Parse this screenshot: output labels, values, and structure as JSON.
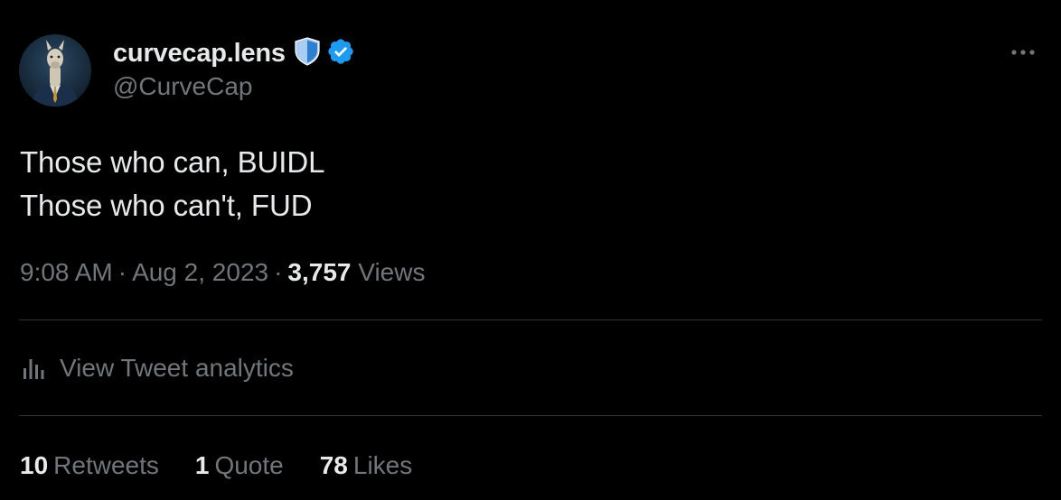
{
  "author": {
    "display_name": "curvecap.lens",
    "handle": "@CurveCap",
    "avatar": "alpaca-in-suit-avatar",
    "badges": [
      "shield-icon",
      "verified-icon"
    ]
  },
  "tweet": {
    "lines": [
      "Those who can, BUIDL",
      "Those who can't, FUD"
    ]
  },
  "meta": {
    "time": "9:08 AM",
    "separator": "·",
    "date": "Aug 2, 2023",
    "views_count": "3,757",
    "views_label": "Views"
  },
  "analytics": {
    "label": "View Tweet analytics",
    "icon": "analytics-icon"
  },
  "stats": {
    "retweets_count": "10",
    "retweets_label": "Retweets",
    "quotes_count": "1",
    "quotes_label": "Quote",
    "likes_count": "78",
    "likes_label": "Likes"
  },
  "colors": {
    "background": "#000000",
    "primary_text": "#e7e9ea",
    "secondary_text": "#71767b",
    "divider": "#2f3336",
    "verified_blue": "#1d9bf0",
    "shield_blue": "#a9cdf2"
  }
}
